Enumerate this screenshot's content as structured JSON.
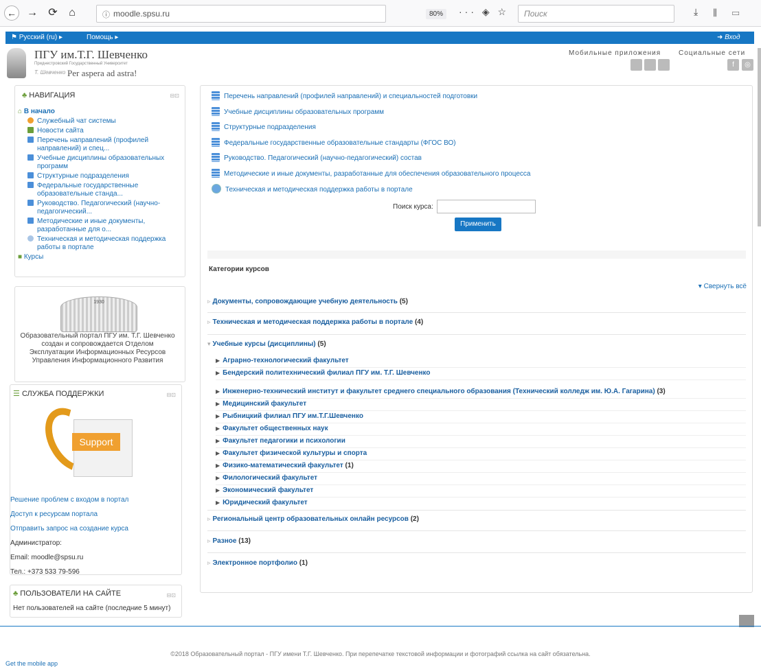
{
  "browser": {
    "back_icon": "←",
    "forward_icon": "→",
    "reload_icon": "⟳",
    "home_icon": "⌂",
    "info_icon": "ⓘ",
    "url": "moodle.spsu.ru",
    "zoom": "80%",
    "page_actions": "··· ◈ ☆",
    "search_placeholder": "Поиск",
    "toolbar_icons": "⤓ ⫴ ▭"
  },
  "topbar": {
    "language": "Русский (ru)",
    "help": "Помощь",
    "login": "Вход"
  },
  "header": {
    "title": "ПГУ им.Т.Г. Шевченко",
    "subtitle": "Приднестровский Государственный Университет",
    "signature": "Т. Шевченко",
    "motto": "Per aspera ad astra!",
    "mobile_apps": "Мобильные приложения",
    "social": "Социальные сети",
    "app_icons": [
      "",
      "",
      ""
    ],
    "social_icons": [
      "f",
      "◎"
    ]
  },
  "nav_block": {
    "title": "НАВИГАЦИЯ",
    "home": "В начало",
    "items": [
      "Служебный чат системы",
      "Новости сайта",
      "Перечень направлений (профилей направлений) и спец...",
      "Учебные дисциплины образовательных программ",
      "Структурные подразделения",
      "Федеральные государственные образовательные станда...",
      "Руководство. Педагогический (научно-педагогический...",
      "Методические и иные документы, разработанные для о...",
      "Техническая и методическая поддержка работы в портале"
    ],
    "courses": "Курсы"
  },
  "about_block": {
    "image_year": "1930",
    "text": "Образовательный портал ПГУ им. Т.Г. Шевченко создан и сопровождается Отделом Эксплуатации Информационных Ресурсов Управления Информационного Развития"
  },
  "support_block": {
    "title": "СЛУЖБА ПОДДЕРЖКИ",
    "badge": "Support",
    "links": [
      "Решение проблем с входом в портал",
      "Доступ к ресурсам портала",
      "Отправить запрос на создание курса"
    ],
    "admin_label": "Администратор:",
    "email": "Email: moodle@spsu.ru",
    "phone": "Тел.: +373 533 79-596"
  },
  "users_block": {
    "title": "ПОЛЬЗОВАТЕЛИ НА САЙТЕ",
    "text": "Нет пользователей на сайте (последние 5 минут)"
  },
  "main": {
    "menu": [
      "Перечень направлений (профилей направлений) и специальностей подготовки",
      "Учебные дисциплины образовательных программ",
      "Структурные подразделения",
      "Федеральные государственные образовательные стандарты (ФГОС ВО)",
      "Руководство. Педагогический (научно-педагогический) состав",
      "Методические и иные документы, разработанные для обеспечения образовательного процесса",
      "Техническая и методическая поддержка работы в портале"
    ],
    "search_label": "Поиск курса:",
    "apply": "Применить",
    "categories_title": "Категории курсов",
    "collapse_all": "▾ Свернуть всё",
    "categories": [
      {
        "name": "Документы, сопровождающие учебную деятельность",
        "count": "(5)"
      },
      {
        "name": "Техническая и методическая поддержка работы в портале",
        "count": "(4)"
      },
      {
        "name": "Учебные курсы (дисциплины)",
        "count": "(5)"
      },
      {
        "name": "Региональный центр образовательных онлайн ресурсов",
        "count": "(2)"
      },
      {
        "name": "Разное",
        "count": "(13)"
      },
      {
        "name": "Электронное портфолио",
        "count": "(1)"
      }
    ],
    "subcategories": [
      {
        "name": "Аграрно-технологический факультет",
        "count": ""
      },
      {
        "name": "Бендерский политехнический филиал ПГУ им. Т.Г. Шевченко",
        "count": ""
      },
      {
        "name": "Инженерно-технический институт и факультет среднего специального образования (Технический колледж им. Ю.А. Гагарина)",
        "count": "(3)"
      },
      {
        "name": "Медицинский факультет",
        "count": ""
      },
      {
        "name": "Рыбницкий филиал ПГУ им.Т.Г.Шевченко",
        "count": ""
      },
      {
        "name": "Факультет общественных наук",
        "count": ""
      },
      {
        "name": "Факультет педагогики и психологии",
        "count": ""
      },
      {
        "name": "Факультет физической культуры и спорта",
        "count": ""
      },
      {
        "name": "Физико-математический факультет",
        "count": "(1)"
      },
      {
        "name": "Филологический факультет",
        "count": ""
      },
      {
        "name": "Экономический факультет",
        "count": ""
      },
      {
        "name": "Юридический факультет",
        "count": ""
      }
    ]
  },
  "footer": {
    "text": "©2018 Образовательный портал - ПГУ имени Т.Г. Шевченко. При перепечатке текстовой информации и фотографий ссылка на сайт обязательна.",
    "mobile_app": "Get the mobile app"
  },
  "colors": {
    "accent": "#1777c4",
    "link": "#1a6fb5",
    "support_orange": "#f0a030"
  }
}
